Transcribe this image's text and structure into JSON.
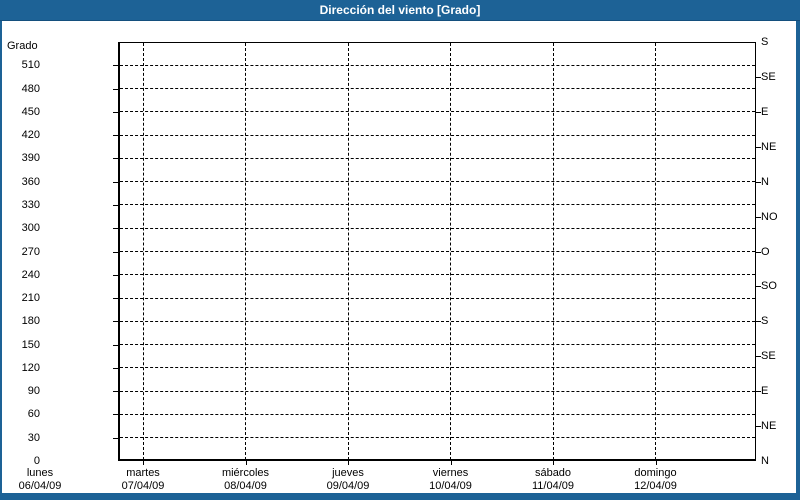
{
  "window_title": "Dirección del viento [Grado]",
  "colors": {
    "titlebar": "#1d6296",
    "titlebar_edge": "#144f7d",
    "frame": "#1d6296",
    "panel": "#ffffff",
    "grid": "#000000",
    "text": "#000000",
    "title_text": "#ffffff"
  },
  "chart_data": {
    "type": "line",
    "title": "Dirección del viento [Grado]",
    "series": [],
    "grid": true,
    "legend": false,
    "y_axis_left": {
      "label": "Grado",
      "min": 0,
      "max": 540,
      "tick_step": 30,
      "tick_labels_top_to_bottom": [
        "510",
        "480",
        "450",
        "420",
        "390",
        "360",
        "330",
        "300",
        "270",
        "240",
        "210",
        "180",
        "150",
        "120",
        "90",
        "60",
        "30",
        "0"
      ]
    },
    "y_axis_right": {
      "tick_step_degrees": 45,
      "labels_top_to_bottom": [
        "S",
        "SE",
        "E",
        "NE",
        "N",
        "NO",
        "O",
        "SO",
        "S",
        "SE",
        "E",
        "NE",
        "N"
      ]
    },
    "x_axis": {
      "days": [
        {
          "name": "lunes",
          "date": "06/04/09"
        },
        {
          "name": "martes",
          "date": "07/04/09"
        },
        {
          "name": "miércoles",
          "date": "08/04/09"
        },
        {
          "name": "jueves",
          "date": "09/04/09"
        },
        {
          "name": "viernes",
          "date": "10/04/09"
        },
        {
          "name": "sábado",
          "date": "11/04/09"
        },
        {
          "name": "domingo",
          "date": "12/04/09"
        }
      ]
    }
  }
}
